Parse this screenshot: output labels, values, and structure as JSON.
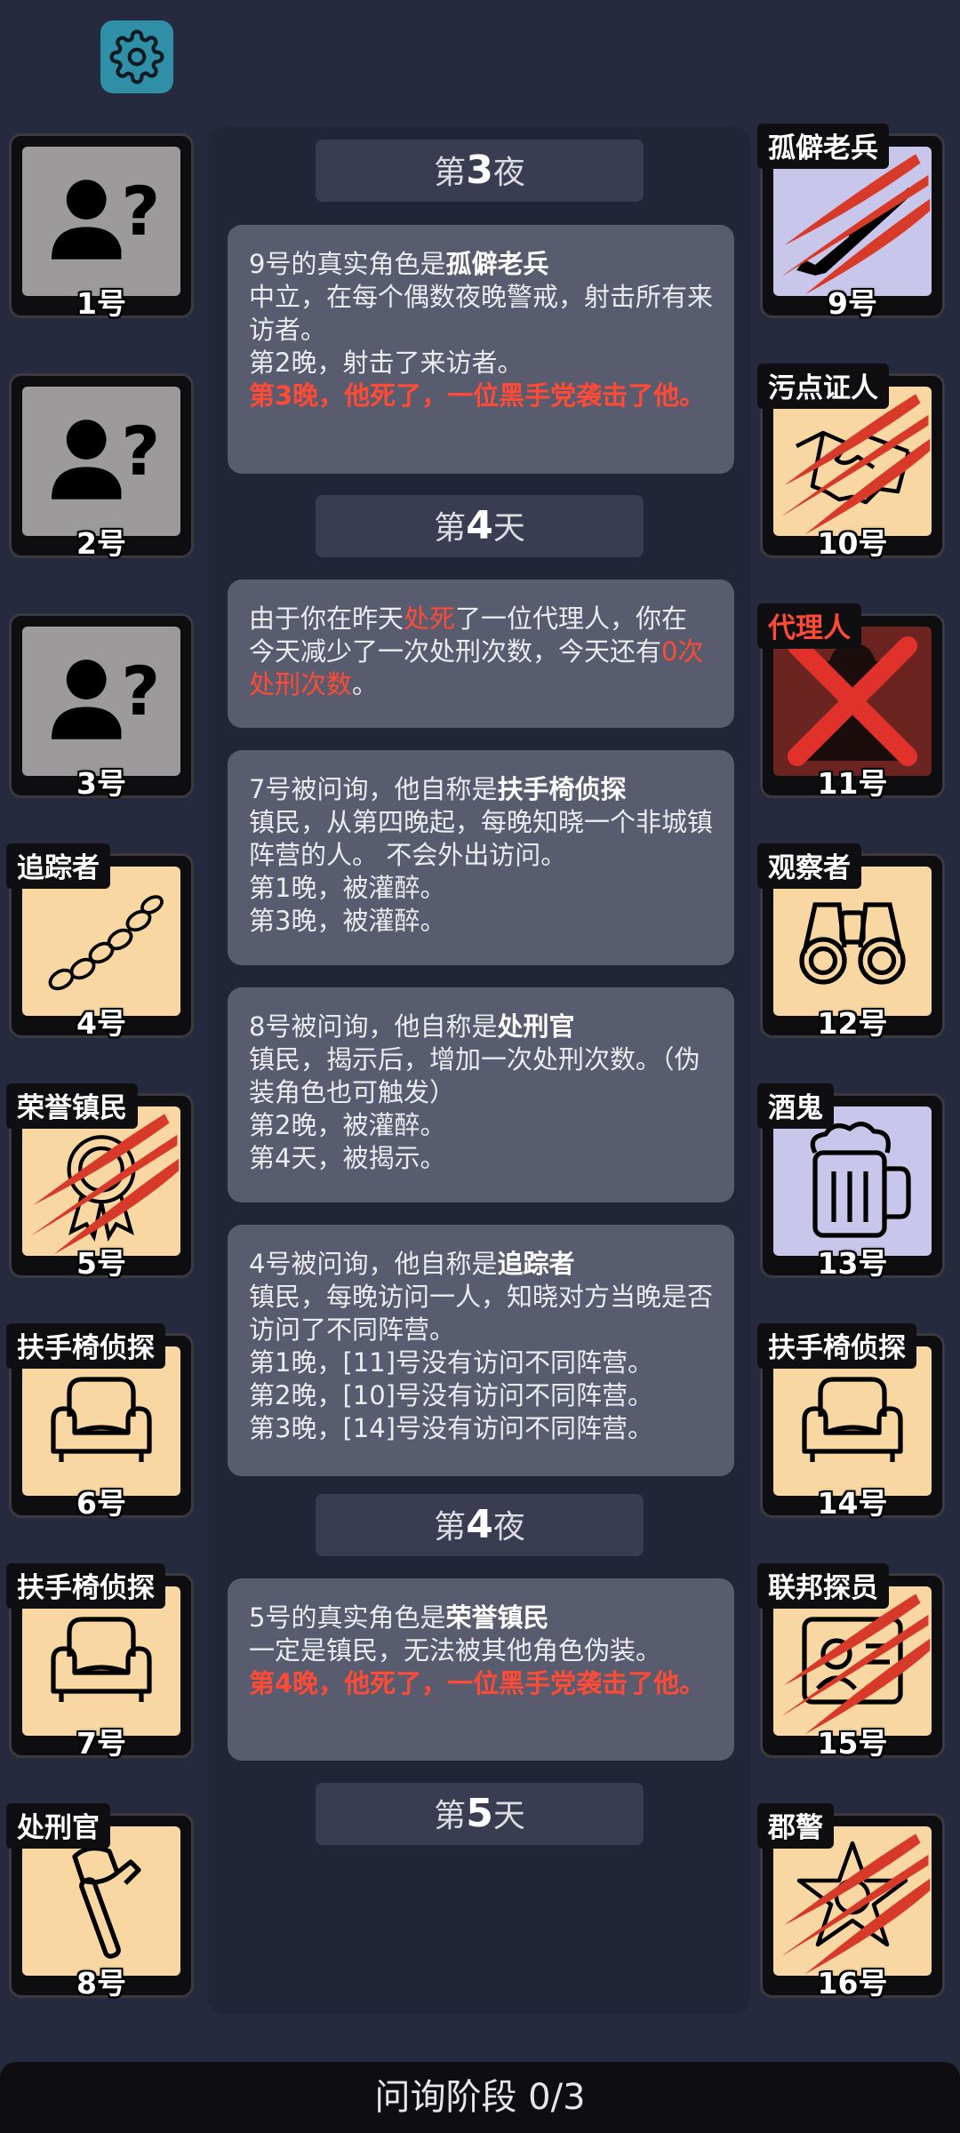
{
  "settings_icon": "gear-icon",
  "left_players": [
    {
      "num": "1号",
      "role": "",
      "style": "unknown",
      "icon": "unknown-person-icon"
    },
    {
      "num": "2号",
      "role": "",
      "style": "unknown",
      "icon": "unknown-person-icon"
    },
    {
      "num": "3号",
      "role": "",
      "style": "unknown",
      "icon": "unknown-person-icon"
    },
    {
      "num": "4号",
      "role": "追踪者",
      "style": "town",
      "icon": "footprints-icon"
    },
    {
      "num": "5号",
      "role": "荣誉镇民",
      "style": "town",
      "icon": "medal-icon",
      "dead": "claw"
    },
    {
      "num": "6号",
      "role": "扶手椅侦探",
      "style": "town",
      "icon": "armchair-icon"
    },
    {
      "num": "7号",
      "role": "扶手椅侦探",
      "style": "town",
      "icon": "armchair-icon"
    },
    {
      "num": "8号",
      "role": "处刑官",
      "style": "town",
      "icon": "axe-icon"
    }
  ],
  "right_players": [
    {
      "num": "9号",
      "role": "孤僻老兵",
      "style": "neutral",
      "icon": "rifle-icon",
      "dead": "claw"
    },
    {
      "num": "10号",
      "role": "污点证人",
      "style": "town",
      "icon": "handshake-icon",
      "dead": "claw"
    },
    {
      "num": "11号",
      "role": "代理人",
      "style": "evil",
      "icon": "agent-icon",
      "dead": "x",
      "tag_red": true
    },
    {
      "num": "12号",
      "role": "观察者",
      "style": "town",
      "icon": "binoculars-icon"
    },
    {
      "num": "13号",
      "role": "酒鬼",
      "style": "neutral",
      "icon": "beer-mug-icon"
    },
    {
      "num": "14号",
      "role": "扶手椅侦探",
      "style": "town",
      "icon": "armchair-icon"
    },
    {
      "num": "15号",
      "role": "联邦探员",
      "style": "town",
      "icon": "badge-id-icon",
      "dead": "claw"
    },
    {
      "num": "16号",
      "role": "郡警",
      "style": "town",
      "icon": "sheriff-star-icon",
      "dead": "claw"
    }
  ],
  "log": {
    "phase1": {
      "pre": "第",
      "n": "3",
      "post": "夜"
    },
    "msg1": {
      "intro_a": "9号的真实角色是",
      "intro_b": "孤僻老兵",
      "desc": "中立，在每个偶数夜晚警戒，射击所有来访者。",
      "line1": "第2晚，射击了来访者。",
      "death": "第3晚，他死了，一位黑手党袭击了他。"
    },
    "phase2": {
      "pre": "第",
      "n": "4",
      "post": "天"
    },
    "msg2": {
      "a": "由于你在昨天",
      "b": "处死",
      "c": "了一位代理人，你在今天减少了一次处刑次数，今天还有",
      "d": "0次处刑次数",
      "e": "。"
    },
    "msg3": {
      "intro_a": "7号被问询，他自称是",
      "intro_b": "扶手椅侦探",
      "desc": "镇民，从第四晚起，每晚知晓一个非城镇阵营的人。 不会外出访问。",
      "line1": "第1晚，被灌醉。",
      "line2": "第3晚，被灌醉。"
    },
    "msg4": {
      "intro_a": "8号被问询，他自称是",
      "intro_b": "处刑官",
      "desc": "镇民，揭示后，增加一次处刑次数。（伪装角色也可触发）",
      "line1": "第2晚，被灌醉。",
      "line2": "第4天，被揭示。"
    },
    "msg5": {
      "intro_a": "4号被问询，他自称是",
      "intro_b": "追踪者",
      "desc": "镇民，每晚访问一人，知晓对方当晚是否访问了不同阵营。",
      "line1": "第1晚，[11]号没有访问不同阵营。",
      "line2": "第2晚，[10]号没有访问不同阵营。",
      "line3": "第3晚，[14]号没有访问不同阵营。"
    },
    "phase3": {
      "pre": "第",
      "n": "4",
      "post": "夜"
    },
    "msg6": {
      "intro_a": "5号的真实角色是",
      "intro_b": "荣誉镇民",
      "desc": "一定是镇民，无法被其他角色伪装。",
      "death": "第4晚，他死了，一位黑手党袭击了他。"
    },
    "phase4": {
      "pre": "第",
      "n": "5",
      "post": "天"
    }
  },
  "bottom_bar": {
    "label": "问询阶段 0/3"
  }
}
